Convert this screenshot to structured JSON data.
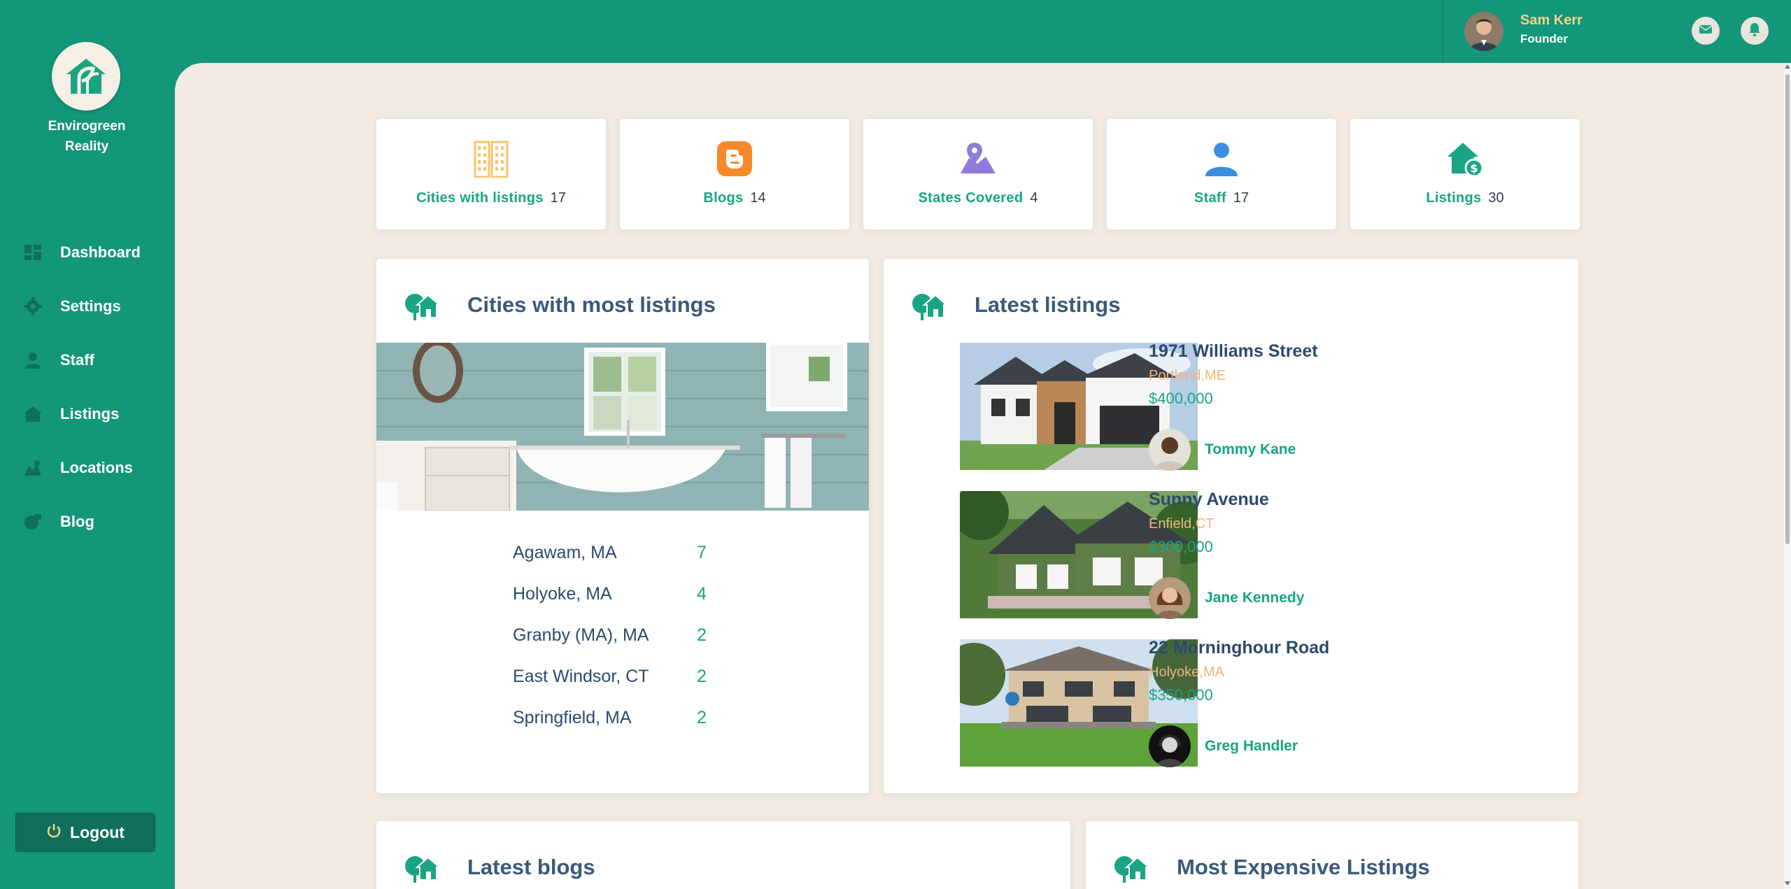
{
  "brand": {
    "line1": "Envirogreen",
    "line2": "Reality"
  },
  "sidebar": {
    "items": [
      {
        "label": "Dashboard",
        "icon": "dashboard-icon"
      },
      {
        "label": "Settings",
        "icon": "gear-icon"
      },
      {
        "label": "Staff",
        "icon": "user-icon"
      },
      {
        "label": "Listings",
        "icon": "house-icon"
      },
      {
        "label": "Locations",
        "icon": "location-icon"
      },
      {
        "label": "Blog",
        "icon": "blog-icon"
      }
    ],
    "logout_label": "Logout"
  },
  "user": {
    "name": "Sam Kerr",
    "role": "Founder"
  },
  "colors": {
    "primary": "#13967a",
    "accent": "#19a583",
    "background": "#f1ebe3",
    "title": "#3a5a7a",
    "location": "#f2b37b"
  },
  "stats": [
    {
      "label": "Cities with listings",
      "value": "17",
      "icon": "buildings-icon"
    },
    {
      "label": "Blogs",
      "value": "14",
      "icon": "blogger-icon"
    },
    {
      "label": "States Covered",
      "value": "4",
      "icon": "map-pin-icon"
    },
    {
      "label": "Staff",
      "value": "17",
      "icon": "person-icon"
    },
    {
      "label": "Listings",
      "value": "30",
      "icon": "house-dollar-icon"
    }
  ],
  "cities_panel": {
    "title": "Cities with most listings",
    "rows": [
      {
        "city": "Agawam, MA",
        "count": "7"
      },
      {
        "city": "Holyoke, MA",
        "count": "4"
      },
      {
        "city": "Granby (MA), MA",
        "count": "2"
      },
      {
        "city": "East Windsor, CT",
        "count": "2"
      },
      {
        "city": "Springfield, MA",
        "count": "2"
      }
    ]
  },
  "latest_listings": {
    "title": "Latest listings",
    "items": [
      {
        "title": "1971 Williams Street",
        "location": "Portland,ME",
        "price": "$400,000",
        "agent": "Tommy Kane"
      },
      {
        "title": "Sunny Avenue",
        "location": "Enfield,CT",
        "price": "$300,000",
        "agent": "Jane Kennedy"
      },
      {
        "title": "22 Morninghour Road",
        "location": "Holyoke,MA",
        "price": "$350,000",
        "agent": "Greg Handler"
      }
    ]
  },
  "latest_blogs": {
    "title": "Latest blogs"
  },
  "expensive_listings": {
    "title": "Most Expensive Listings"
  }
}
